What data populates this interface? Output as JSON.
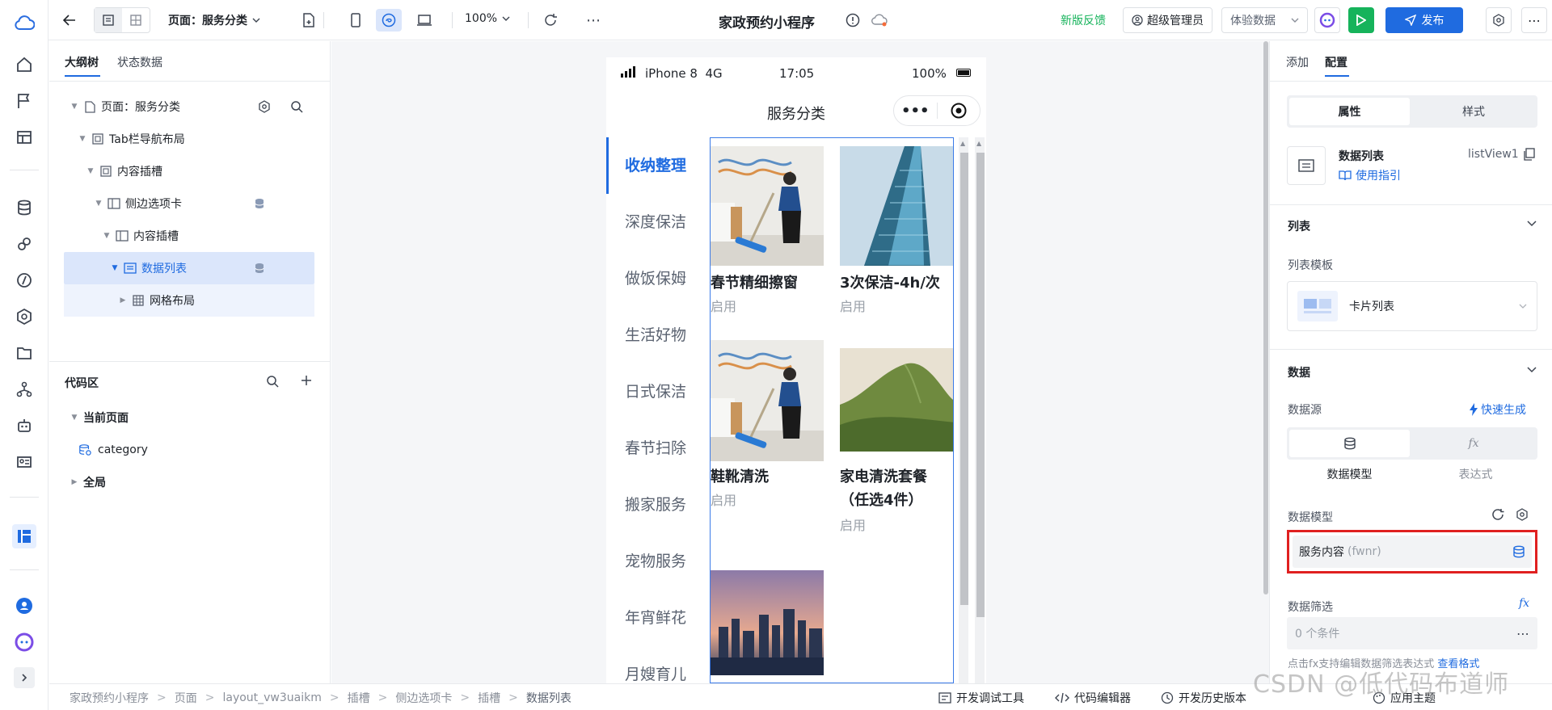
{
  "topbar": {
    "page_label": "页面：服务分类",
    "zoom": "100%",
    "app_title": "家政预约小程序",
    "feedback": "新版反馈",
    "admin": "超级管理员",
    "data_mode": "体验数据",
    "publish": "发布"
  },
  "left": {
    "tab_outline": "大纲树",
    "tab_state": "状态数据",
    "tree": [
      {
        "label": "页面：服务分类"
      },
      {
        "label": "Tab栏导航布局"
      },
      {
        "label": "内容插槽"
      },
      {
        "label": "侧边选项卡"
      },
      {
        "label": "内容插槽"
      },
      {
        "label": "数据列表"
      },
      {
        "label": "网格布局"
      }
    ],
    "code_title": "代码区",
    "current_page": "当前页面",
    "category": "category",
    "global": "全局"
  },
  "phone": {
    "carrier": "iPhone 8  4G",
    "time": "17:05",
    "battery": "100%",
    "nav_title": "服务分类",
    "side_items": [
      "收纳整理",
      "深度保洁",
      "做饭保姆",
      "生活好物",
      "日式保洁",
      "春节扫除",
      "搬家服务",
      "宠物服务",
      "年宵鲜花",
      "月嫂育儿"
    ],
    "cards": [
      {
        "title": "春节精细擦窗",
        "status": "启用"
      },
      {
        "title": "3次保洁-4h/次",
        "status": "启用"
      },
      {
        "title": "鞋靴清洗",
        "status": "启用"
      },
      {
        "title": "家电清洗套餐（任选4件）",
        "status": "启用"
      }
    ]
  },
  "right": {
    "tab_add": "添加",
    "tab_config": "配置",
    "seg_props": "属性",
    "seg_style": "样式",
    "comp_name": "数据列表",
    "comp_guide": "使用指引",
    "comp_id": "listView1",
    "sec_list": "列表",
    "list_template_label": "列表模板",
    "list_template_value": "卡片列表",
    "sec_data": "数据",
    "datasource_label": "数据源",
    "quick_gen": "快速生成",
    "ds_model": "数据模型",
    "ds_expr": "表达式",
    "model_label": "数据模型",
    "model_value": "服务内容",
    "model_code": "(fwnr)",
    "filter_label": "数据筛选",
    "filter_value": "0 个条件",
    "hint": "点击fx支持编辑数据筛选表达式",
    "hint_link": "查看格式"
  },
  "bottom": {
    "crumbs": [
      "家政预约小程序",
      "页面",
      "layout_vw3uaikm",
      "插槽",
      "侧边选项卡",
      "插槽",
      "数据列表"
    ],
    "devtools": "开发调试工具",
    "code_editor": "代码编辑器",
    "history": "开发历史版本",
    "theme": "应用主题"
  },
  "watermark": "CSDN @低代码布道师",
  "colors": {
    "primary": "#1f6be0",
    "green": "#16b35b",
    "highlight_border": "#e02020"
  }
}
